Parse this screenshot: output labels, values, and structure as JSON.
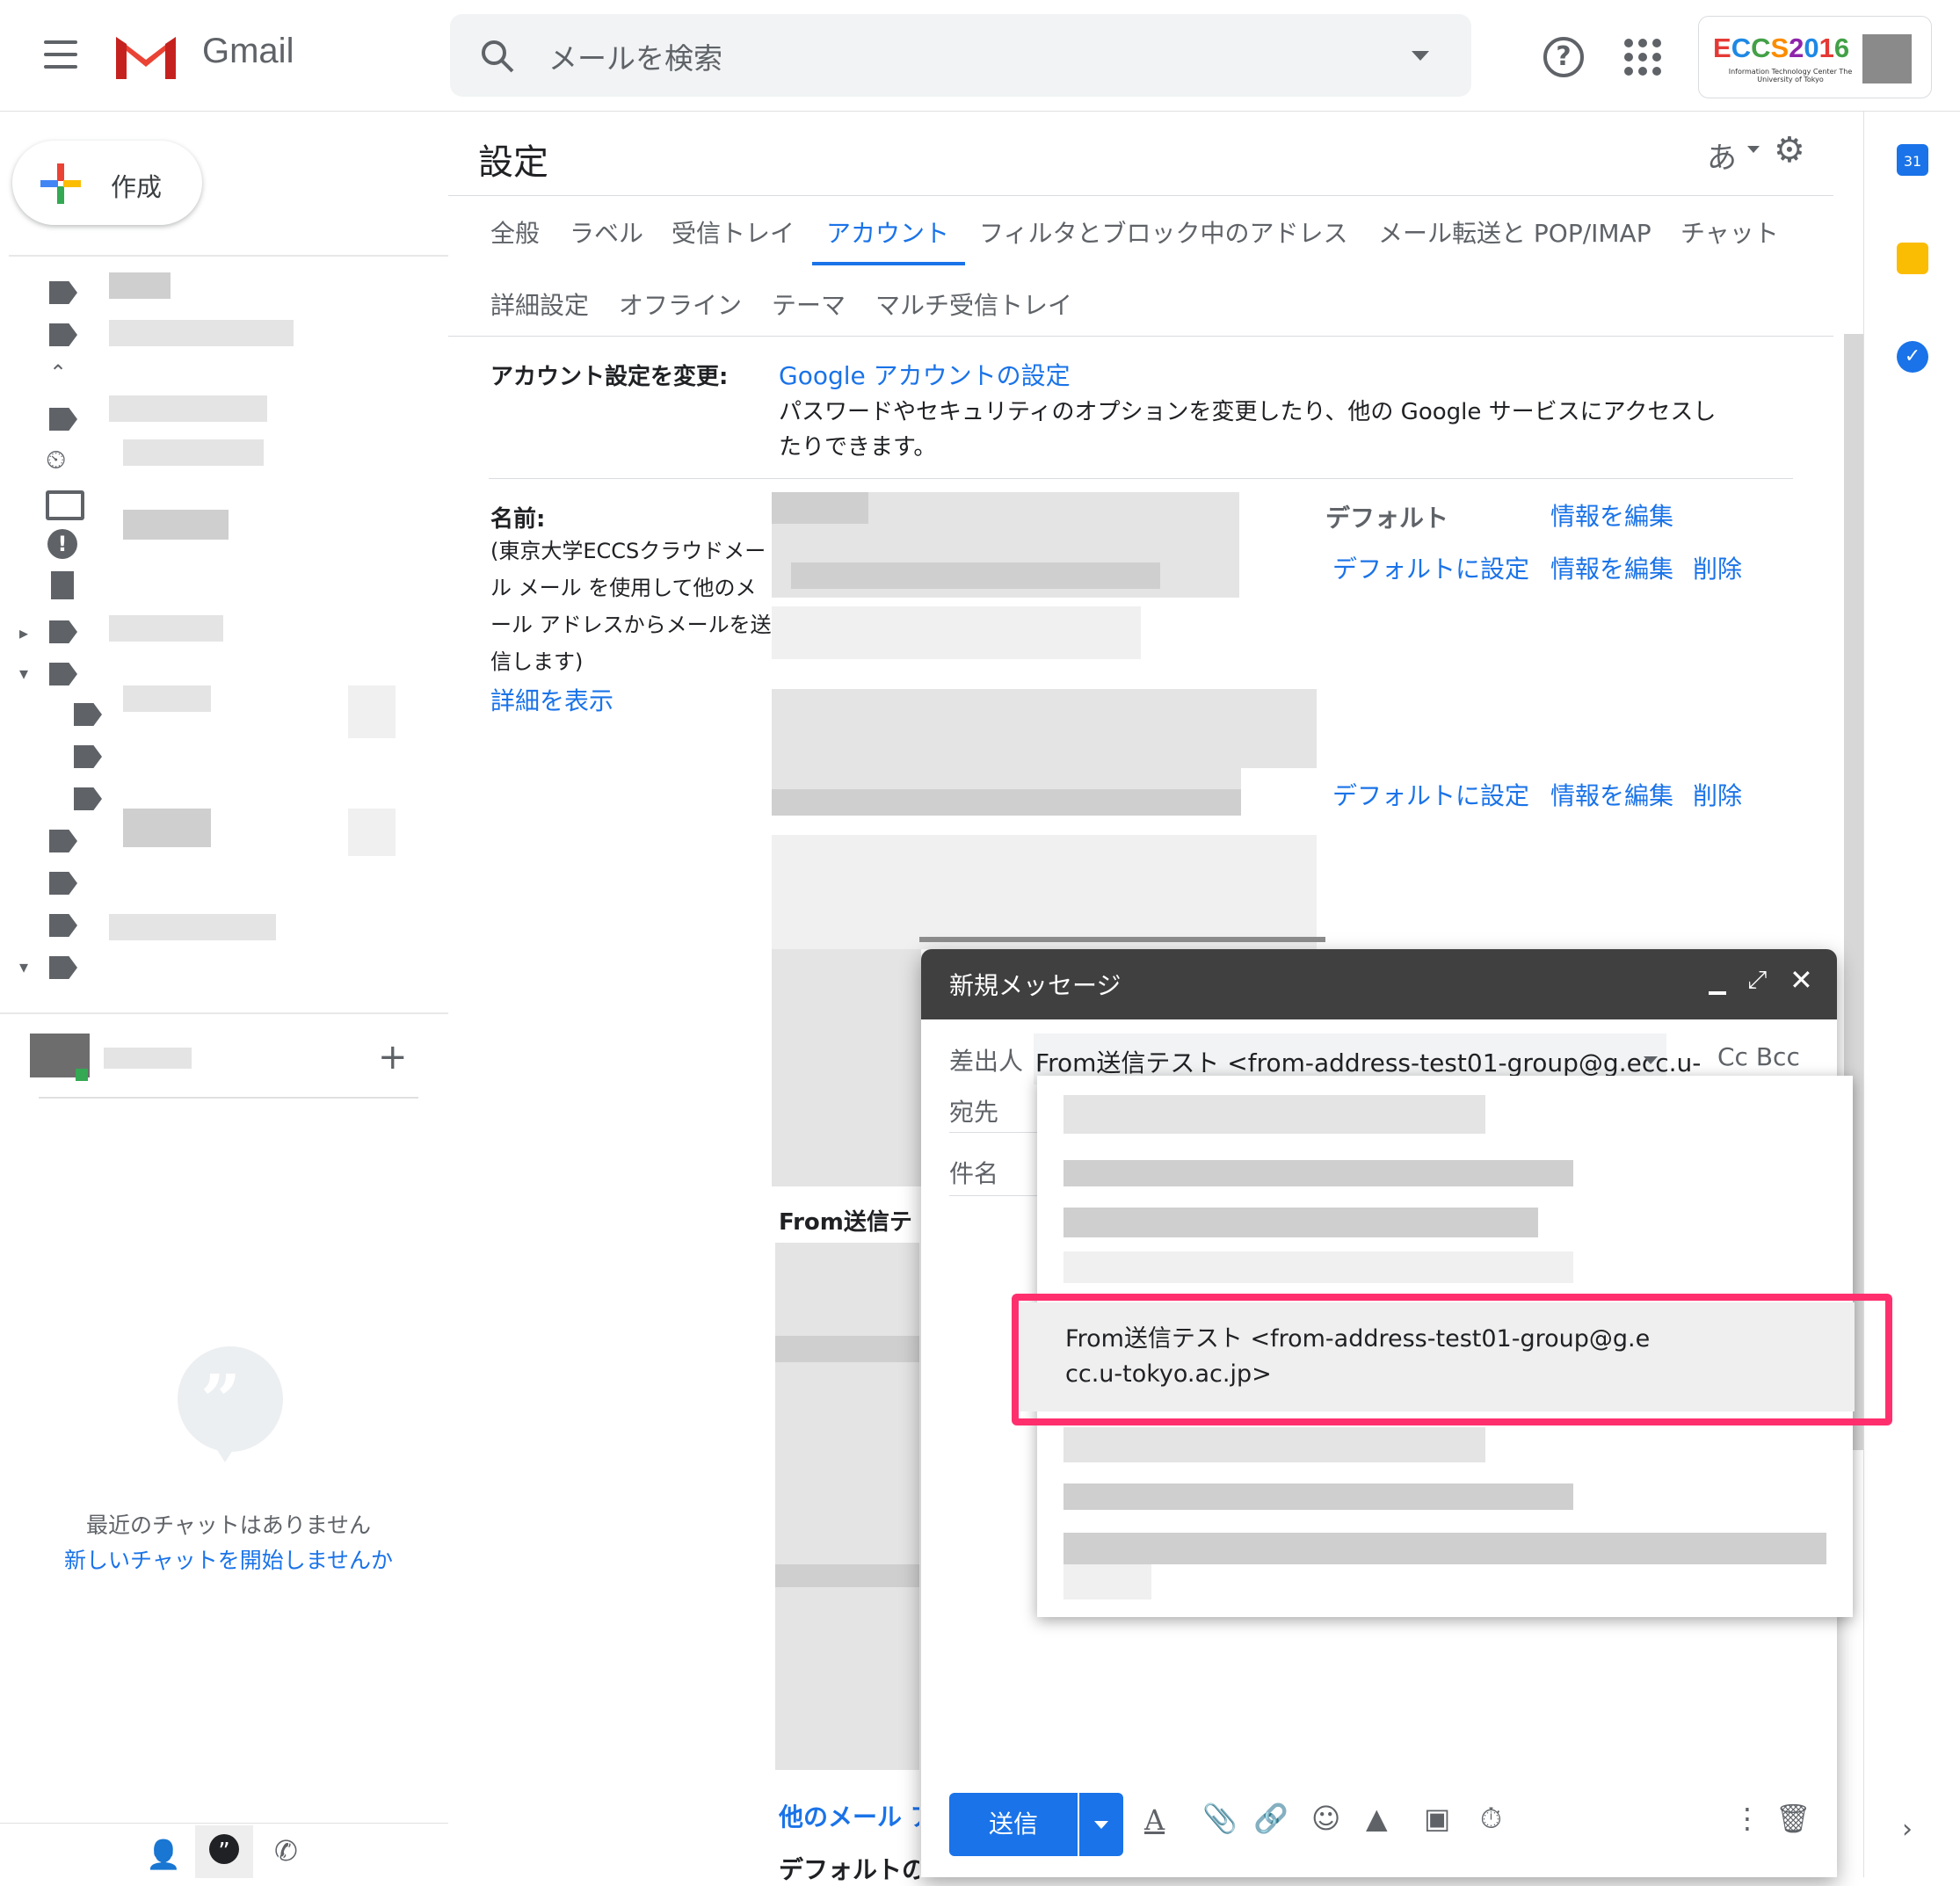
{
  "header": {
    "app_name": "Gmail",
    "search_placeholder": "メールを検索",
    "account_label": "ECCS2016",
    "account_sub": "Information Technology Center The University of Tokyo"
  },
  "sidebar": {
    "compose_label": "作成",
    "no_chat": "最近のチャットはありません",
    "new_chat": "新しいチャットを開始しませんか"
  },
  "settings": {
    "title": "設定",
    "input_tool": "あ",
    "tabs_row1": [
      "全般",
      "ラベル",
      "受信トレイ",
      "アカウント",
      "フィルタとブロック中のアドレス",
      "メール転送と POP/IMAP",
      "チャット"
    ],
    "tabs_row2": [
      "詳細設定",
      "オフライン",
      "テーマ",
      "マルチ受信トレイ"
    ],
    "active_tab": "アカウント",
    "account_change_label": "アカウント設定を変更:",
    "google_account_link": "Google アカウントの設定",
    "google_account_desc1": "パスワードやセキュリティのオプションを変更したり、他の Google サービスにアクセスし",
    "google_account_desc2": "たりできます。",
    "name_label": "名前:",
    "name_desc": [
      "(東京大学ECCSクラウドメー",
      "ル メール を使用して他のメ",
      "ール アドレスからメールを送",
      "信します)"
    ],
    "detail_link": "詳細を表示",
    "row1": {
      "default": "デフォルト",
      "edit": "情報を編集"
    },
    "row2": {
      "set_default": "デフォルトに設定",
      "edit": "情報を編集",
      "delete": "削除"
    },
    "row3": {
      "set_default": "デフォルトに設定",
      "edit": "情報を編集",
      "delete": "削除"
    },
    "from_section": "From送信テ",
    "other_mail": "他のメール ア",
    "default_partial": "デフォルトの"
  },
  "compose": {
    "title": "新規メッセージ",
    "from_label": "差出人",
    "from_value": "From送信テスト <from-address-test01-group@g.ecc.u-",
    "cc_bcc": "Cc Bcc",
    "to_label": "宛先",
    "subject_label": "件名",
    "send_label": "送信"
  },
  "dropdown": {
    "selected_line1": "From送信テスト <from-address-test01-group@g.e",
    "selected_line2": "cc.u-tokyo.ac.jp>",
    "highlight_color": "#ff2f6e"
  },
  "colors": {
    "accent": "#1a73e8",
    "header_dark": "#404040"
  }
}
